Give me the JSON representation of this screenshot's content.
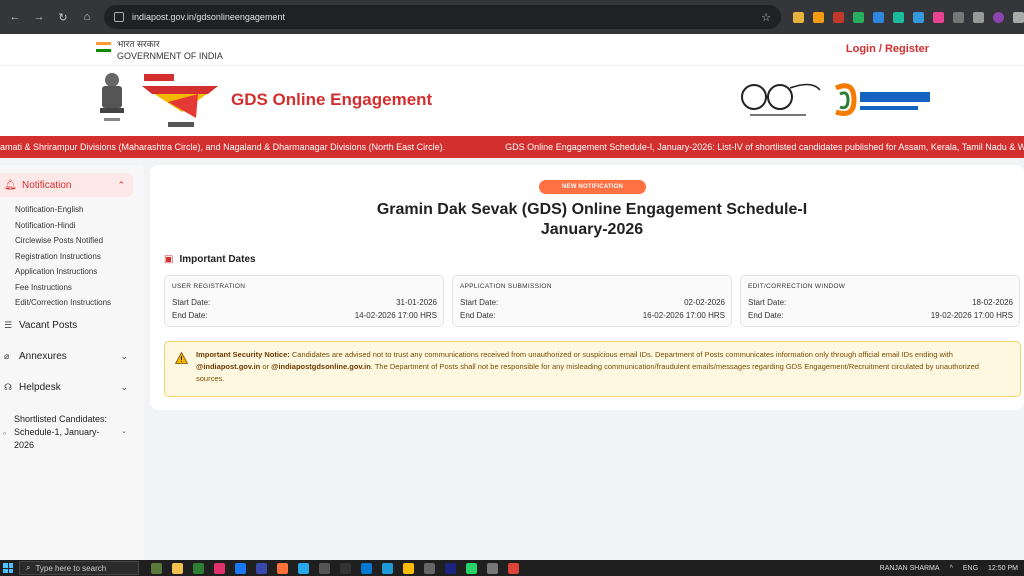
{
  "browser": {
    "url": "indiapost.gov.in/gdsonlineengagement"
  },
  "govstrip": {
    "hindi": "भारत सरकार",
    "english": "GOVERNMENT OF INDIA",
    "login": "Login / Register"
  },
  "header": {
    "title": "GDS Online Engagement"
  },
  "ticker": {
    "items": [
      "amati & Shrirampur Divisions (Maharashtra Circle), and Nagaland & Dharmanagar Divisions (North East Circle).",
      "GDS Online Engagement Schedule-I, January-2026: List-IV of shortlisted candidates published for Assam, Kerala, Tamil Nadu & W"
    ]
  },
  "sidebar": {
    "notification": "Notification",
    "subitems": [
      "Notification-English",
      "Notification-Hindi",
      "Circlewise Posts Notified",
      "Registration Instructions",
      "Application Instructions",
      "Fee Instructions",
      "Edit/Correction Instructions"
    ],
    "vacant": "Vacant Posts",
    "annexures": "Annexures",
    "helpdesk": "Helpdesk",
    "shortlisted": "Shortlisted Candidates: Schedule-1, January-2026"
  },
  "main": {
    "badge": "NEW NOTIFICATION",
    "title_line1": "Gramin Dak Sevak (GDS) Online Engagement Schedule-I",
    "title_line2": "January-2026",
    "dates_heading": "Important Dates",
    "cards": [
      {
        "title": "USER REGISTRATION",
        "start_label": "Start Date:",
        "start": "31-01-2026",
        "end_label": "End Date:",
        "end": "14-02-2026 17:00 HRS"
      },
      {
        "title": "APPLICATION SUBMISSION",
        "start_label": "Start Date:",
        "start": "02-02-2026",
        "end_label": "End Date:",
        "end": "16-02-2026 17:00 HRS"
      },
      {
        "title": "EDIT/CORRECTION WINDOW",
        "start_label": "Start Date:",
        "start": "18-02-2026",
        "end_label": "End Date:",
        "end": "19-02-2026 17:00 HRS"
      }
    ],
    "notice": {
      "label": "Important Security Notice:",
      "text1": "Candidates are advised not to trust any communications received from unauthorized or suspicious email IDs. Department of Posts communicates information only through official email IDs ending with",
      "email1": "@indiapost.gov.in",
      "or": "or",
      "email2": "@indiapostgdsonline.gov.in",
      "text2": ". The Department of Posts shall not be responsible for any misleading communication/fraudulent emails/messages regarding GDS Engagement/Recruitment circulated by unauthorized sources."
    }
  },
  "taskbar": {
    "search": "Type here to search",
    "user": "RANJAN SHARMA",
    "lang": "ENG",
    "time": "12:50 PM"
  },
  "colors": {
    "brand_red": "#d32f2f",
    "badge_orange": "#ff7043",
    "notice_bg": "#fff8e1"
  }
}
